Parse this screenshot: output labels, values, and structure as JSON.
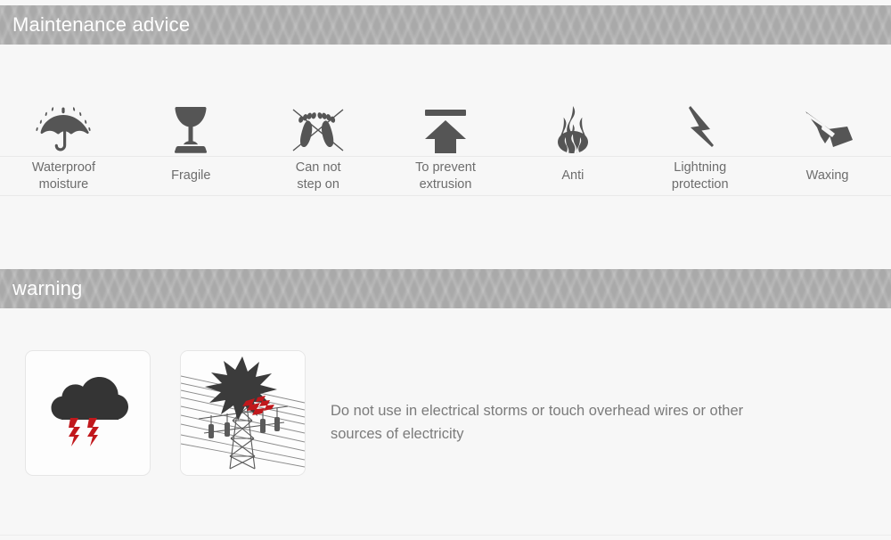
{
  "sections": {
    "maintenance": {
      "title": "Maintenance advice",
      "items": [
        {
          "label": "Waterproof\nmoisture",
          "icon": "umbrella-rain-icon"
        },
        {
          "label": "Fragile",
          "icon": "wine-goblet-icon"
        },
        {
          "label": "Can not\nstep on",
          "icon": "no-step-footprints-icon"
        },
        {
          "label": "To prevent\nextrusion",
          "icon": "up-arrow-under-bar-icon"
        },
        {
          "label": "Anti",
          "icon": "flame-icon"
        },
        {
          "label": "Lightning\nprotection",
          "icon": "lightning-bolt-icon"
        },
        {
          "label": "Waxing",
          "icon": "wax-brush-icon"
        }
      ]
    },
    "warning": {
      "title": "warning",
      "media": [
        {
          "name": "storm-cloud-lightning-image",
          "alt": "storm cloud with red lightning"
        },
        {
          "name": "power-transmission-tower-image",
          "alt": "electrical pylon struck by lightning"
        }
      ],
      "text": "Do not use in electrical storms or touch overhead wires or other sources of electricity"
    }
  },
  "colors": {
    "bar_background": "#a9a9a9",
    "bar_text": "#ffffff",
    "page_background": "#f7f7f7",
    "icon_fill": "#555555",
    "label_text": "#6d6d6d",
    "body_text": "#7b7b7b",
    "accent_red": "#c1181c",
    "card_border": "#e6e6e6"
  }
}
